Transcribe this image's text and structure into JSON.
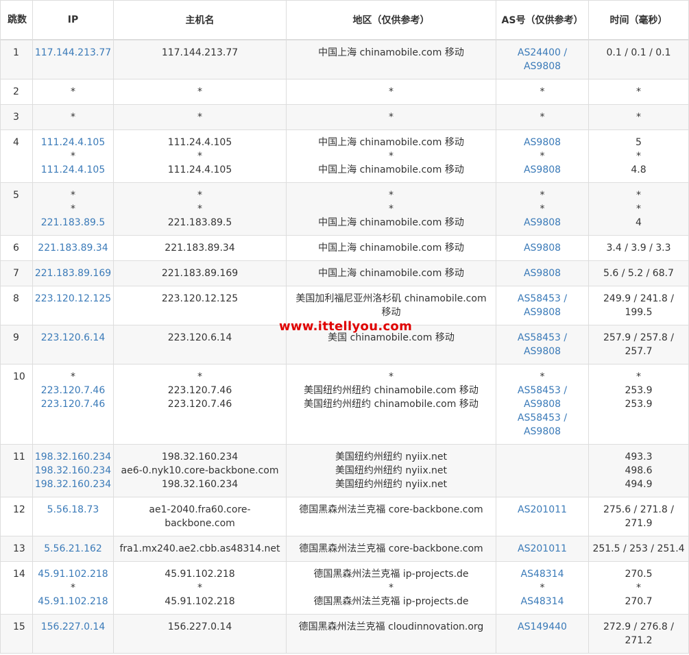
{
  "headers": {
    "hop": "跳数",
    "ip": "IP",
    "hostname": "主机名",
    "region": "地区（仅供参考）",
    "as": "AS号（仅供参考）",
    "time": "时间（毫秒）"
  },
  "watermark": "www.ittellyou.com",
  "rows": [
    {
      "hop": "1",
      "ip": [
        "117.144.213.77"
      ],
      "host": [
        "117.144.213.77"
      ],
      "region": [
        "中国上海 chinamobile.com 移动"
      ],
      "as": [
        "AS24400 /",
        "AS9808"
      ],
      "time": [
        "0.1 / 0.1 / 0.1"
      ]
    },
    {
      "hop": "2",
      "ip": [
        "*"
      ],
      "host": [
        "*"
      ],
      "region": [
        "*"
      ],
      "as": [
        "*"
      ],
      "time": [
        "*"
      ]
    },
    {
      "hop": "3",
      "ip": [
        "*"
      ],
      "host": [
        "*"
      ],
      "region": [
        "*"
      ],
      "as": [
        "*"
      ],
      "time": [
        "*"
      ]
    },
    {
      "hop": "4",
      "ip": [
        "111.24.4.105",
        "*",
        "111.24.4.105"
      ],
      "host": [
        "111.24.4.105",
        "*",
        "111.24.4.105"
      ],
      "region": [
        "中国上海 chinamobile.com 移动",
        "*",
        "中国上海 chinamobile.com 移动"
      ],
      "as": [
        "AS9808",
        "*",
        "AS9808"
      ],
      "time": [
        "5",
        "*",
        "4.8"
      ]
    },
    {
      "hop": "5",
      "ip": [
        "*",
        "*",
        "221.183.89.5"
      ],
      "host": [
        "*",
        "*",
        "221.183.89.5"
      ],
      "region": [
        "*",
        "*",
        "中国上海 chinamobile.com 移动"
      ],
      "as": [
        "*",
        "*",
        "AS9808"
      ],
      "time": [
        "*",
        "*",
        "4"
      ]
    },
    {
      "hop": "6",
      "ip": [
        "221.183.89.34"
      ],
      "host": [
        "221.183.89.34"
      ],
      "region": [
        "中国上海 chinamobile.com 移动"
      ],
      "as": [
        "AS9808"
      ],
      "time": [
        "3.4 / 3.9 / 3.3"
      ]
    },
    {
      "hop": "7",
      "ip": [
        "221.183.89.169"
      ],
      "host": [
        "221.183.89.169"
      ],
      "region": [
        "中国上海 chinamobile.com 移动"
      ],
      "as": [
        "AS9808"
      ],
      "time": [
        "5.6 / 5.2 / 68.7"
      ]
    },
    {
      "hop": "8",
      "ip": [
        "223.120.12.125"
      ],
      "host": [
        "223.120.12.125"
      ],
      "region": [
        "美国加利福尼亚州洛杉矶 chinamobile.com",
        "移动"
      ],
      "as": [
        "AS58453 /",
        "AS9808"
      ],
      "time": [
        "249.9 / 241.8 /",
        "199.5"
      ]
    },
    {
      "hop": "9",
      "ip": [
        "223.120.6.14"
      ],
      "host": [
        "223.120.6.14"
      ],
      "region": [
        "美国 chinamobile.com 移动"
      ],
      "as": [
        "AS58453 /",
        "AS9808"
      ],
      "time": [
        "257.9 / 257.8 /",
        "257.7"
      ]
    },
    {
      "hop": "10",
      "ip": [
        "*",
        "223.120.7.46",
        "223.120.7.46"
      ],
      "host": [
        "*",
        "223.120.7.46",
        "223.120.7.46"
      ],
      "region": [
        "*",
        "美国纽约州纽约 chinamobile.com 移动",
        "美国纽约州纽约 chinamobile.com 移动"
      ],
      "as": [
        "*",
        "AS58453 /",
        "AS9808",
        "AS58453 /",
        "AS9808"
      ],
      "time": [
        "*",
        "253.9",
        "253.9"
      ]
    },
    {
      "hop": "11",
      "ip": [
        "198.32.160.234",
        "198.32.160.234",
        "198.32.160.234"
      ],
      "host": [
        "198.32.160.234",
        "ae6-0.nyk10.core-backbone.com",
        "198.32.160.234"
      ],
      "region": [
        "美国纽约州纽约 nyiix.net",
        "美国纽约州纽约 nyiix.net",
        "美国纽约州纽约 nyiix.net"
      ],
      "as": [],
      "time": [
        "493.3",
        "498.6",
        "494.9"
      ]
    },
    {
      "hop": "12",
      "ip": [
        "5.56.18.73"
      ],
      "host": [
        "ae1-2040.fra60.core-",
        "backbone.com"
      ],
      "region": [
        "德国黑森州法兰克福 core-backbone.com"
      ],
      "as": [
        "AS201011"
      ],
      "time": [
        "275.6 / 271.8 /",
        "271.9"
      ]
    },
    {
      "hop": "13",
      "ip": [
        "5.56.21.162"
      ],
      "host": [
        "fra1.mx240.ae2.cbb.as48314.net"
      ],
      "region": [
        "德国黑森州法兰克福 core-backbone.com"
      ],
      "as": [
        "AS201011"
      ],
      "time": [
        "251.5 / 253 / 251.4"
      ]
    },
    {
      "hop": "14",
      "ip": [
        "45.91.102.218",
        "*",
        "45.91.102.218"
      ],
      "host": [
        "45.91.102.218",
        "*",
        "45.91.102.218"
      ],
      "region": [
        "德国黑森州法兰克福 ip-projects.de",
        "*",
        "德国黑森州法兰克福 ip-projects.de"
      ],
      "as": [
        "AS48314",
        "*",
        "AS48314"
      ],
      "time": [
        "270.5",
        "*",
        "270.7"
      ]
    },
    {
      "hop": "15",
      "ip": [
        "156.227.0.14"
      ],
      "host": [
        "156.227.0.14"
      ],
      "region": [
        "德国黑森州法兰克福 cloudinnovation.org"
      ],
      "as": [
        "AS149440"
      ],
      "time": [
        "272.9 / 276.8 /",
        "271.2"
      ]
    }
  ]
}
